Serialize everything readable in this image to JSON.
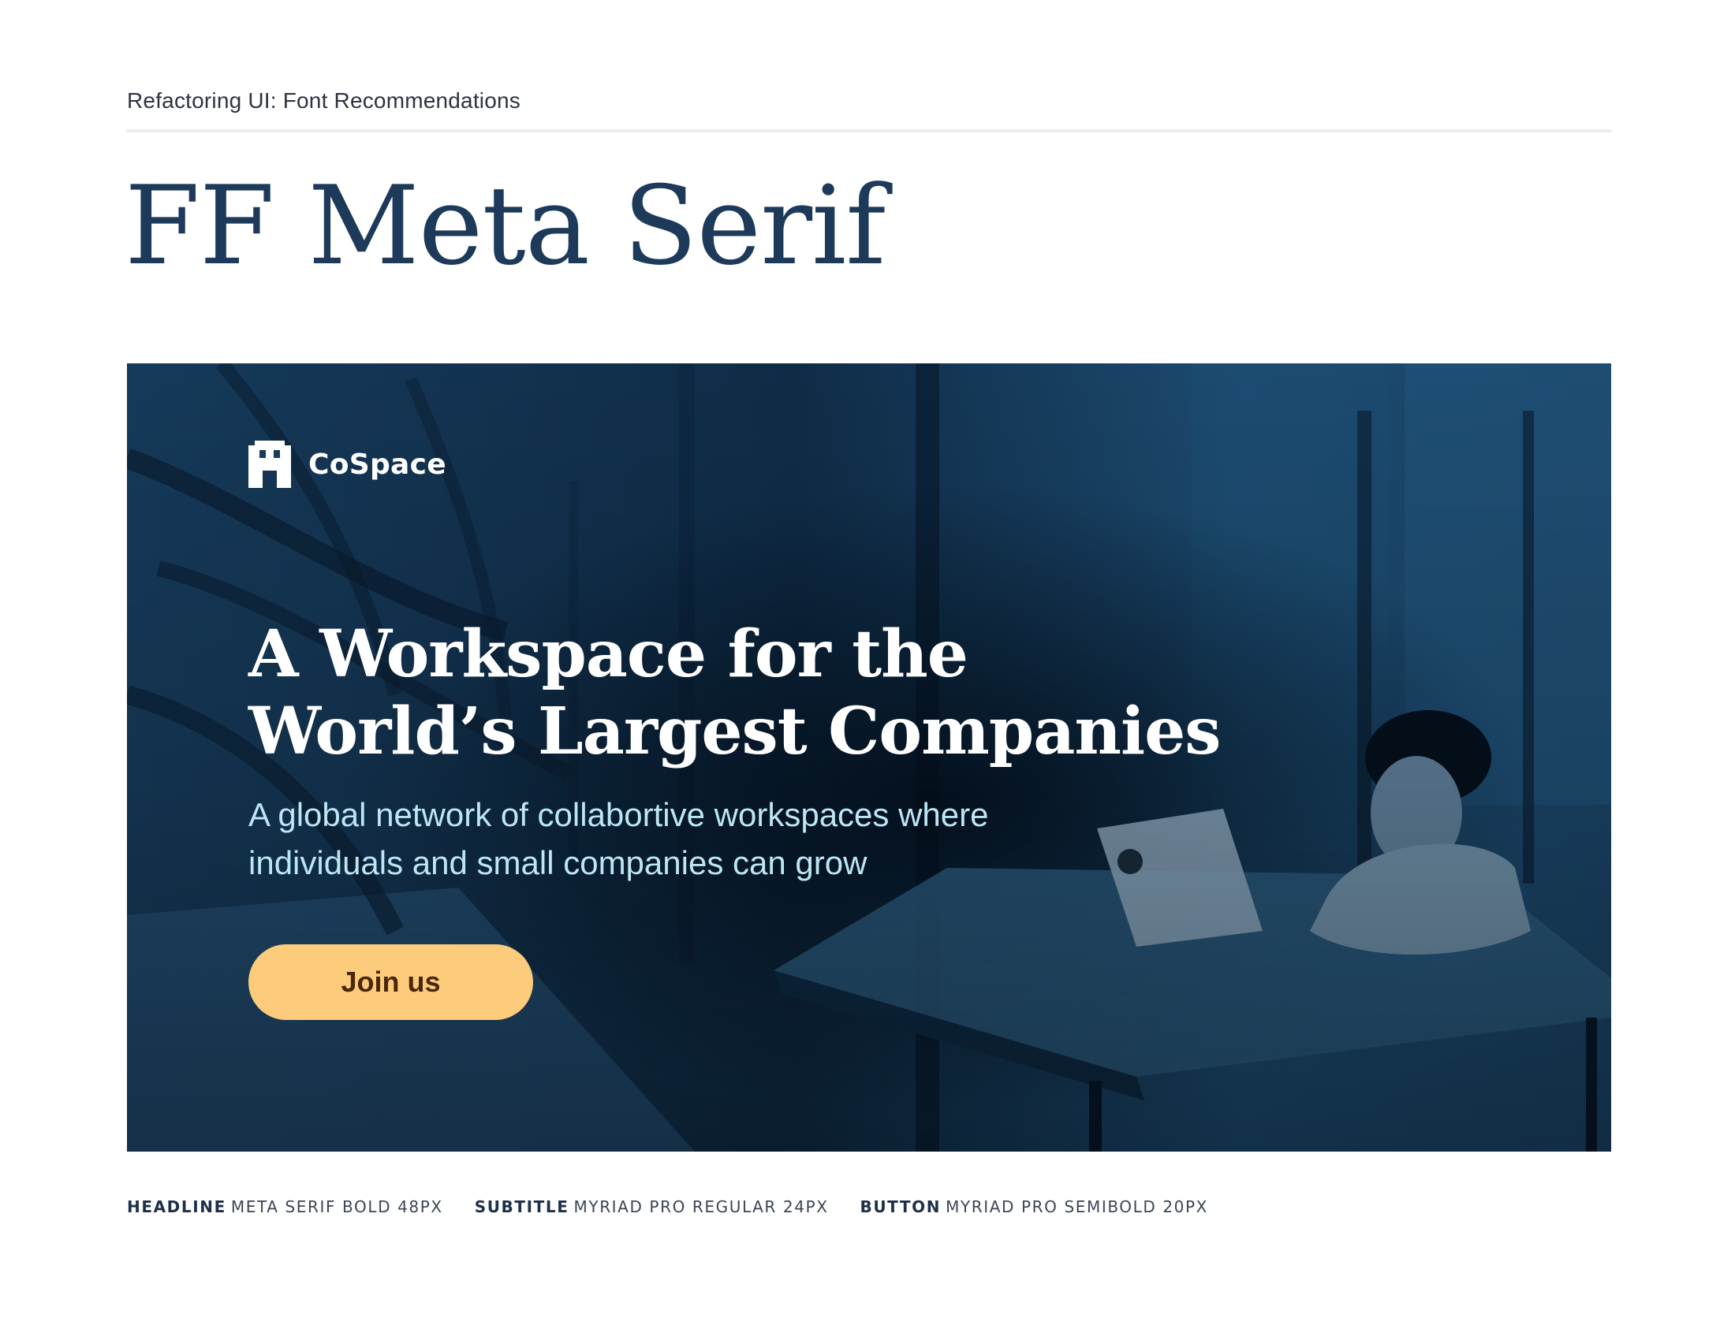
{
  "header": {
    "title": "Refactoring UI: Font Recommendations"
  },
  "font_name": "FF Meta Serif",
  "hero": {
    "brand": {
      "name": "CoSpace",
      "icon": "building-icon"
    },
    "headline_line1": "A Workspace for the",
    "headline_line2": "World’s Largest Companies",
    "subtitle_line1": "A global network of collabortive workspaces where",
    "subtitle_line2": "individuals and small companies can grow",
    "button_label": "Join us"
  },
  "specs": [
    {
      "label": "HEADLINE",
      "value": "META SERIF BOLD 48PX"
    },
    {
      "label": "SUBTITLE",
      "value": "MYRIAD PRO REGULAR 24PX"
    },
    {
      "label": "BUTTON",
      "value": "MYRIAD PRO SEMIBOLD 20PX"
    }
  ],
  "colors": {
    "title": "#1e3a5a",
    "hero_overlay": "#173b5c",
    "subtitle": "#bde6f5",
    "button_bg": "#fccb7b",
    "button_text": "#4b2709"
  }
}
